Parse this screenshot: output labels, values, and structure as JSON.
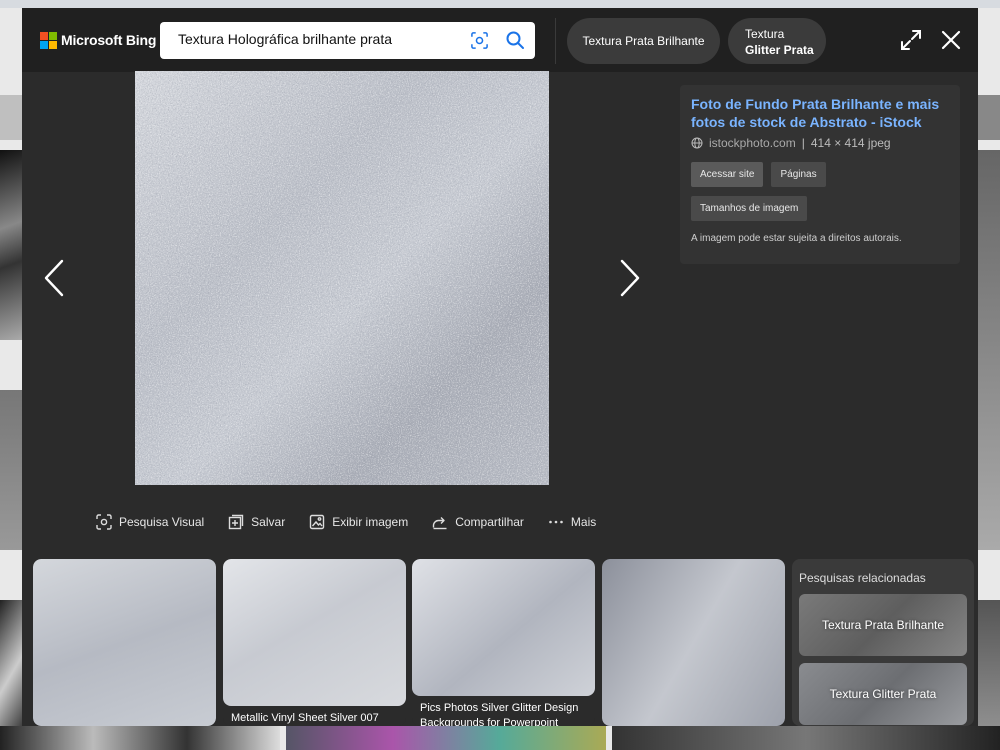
{
  "header": {
    "logo_text": "Microsoft Bing",
    "search_value": "Textura Holográfica brilhante prata",
    "related_pills": [
      {
        "line1": "Textura Prata Brilhante"
      },
      {
        "line1": "Textura",
        "line2": "Glitter Prata"
      }
    ]
  },
  "info": {
    "title": "Foto de Fundo Prata Brilhante e mais fotos de stock de Abstrato - iStock",
    "domain": "istockphoto.com",
    "separator": "|",
    "dimensions": "414 × 414 jpeg",
    "buttons": {
      "visit": "Acessar site",
      "pages": "Páginas",
      "sizes": "Tamanhos de imagem"
    },
    "notice": "A imagem pode estar sujeita a direitos autorais."
  },
  "actions": {
    "visual_search": "Pesquisa Visual",
    "save": "Salvar",
    "view_image": "Exibir imagem",
    "share": "Compartilhar",
    "more": "Mais"
  },
  "thumbnails": [
    {
      "caption": ""
    },
    {
      "caption": "Metallic Vinyl Sheet Silver 007"
    },
    {
      "caption": "Pics Photos Silver Glitter Design Backgrounds for Powerpoint"
    },
    {
      "caption": ""
    }
  ],
  "related": {
    "title": "Pesquisas relacionadas",
    "items": [
      "Textura Prata Brilhante",
      "Textura Glitter Prata"
    ]
  },
  "colors": {
    "modal_bg": "#2b2b2b",
    "topbar_bg": "#202020",
    "link": "#7ab4ff",
    "ms_red": "#f25022",
    "ms_green": "#7fba00",
    "ms_blue": "#00a4ef",
    "ms_yellow": "#ffb900"
  }
}
